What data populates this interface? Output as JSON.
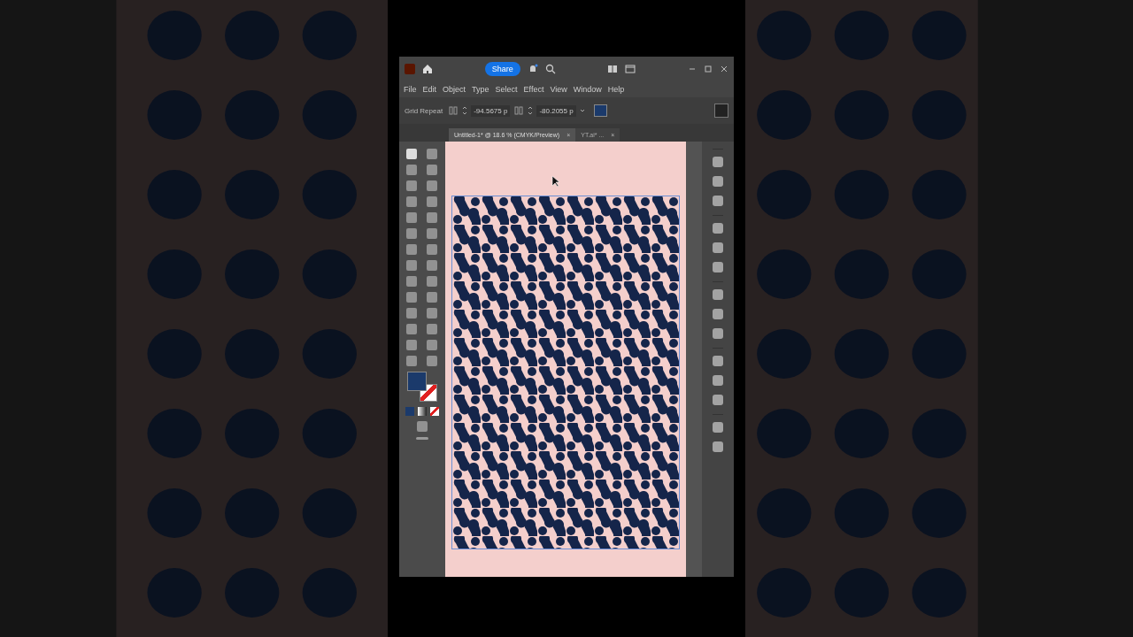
{
  "title_bar": {
    "share_label": "Share"
  },
  "menu": [
    "File",
    "Edit",
    "Object",
    "Type",
    "Select",
    "Effect",
    "View",
    "Window",
    "Help"
  ],
  "control_bar": {
    "label": "Grid Repeat",
    "fields": [
      {
        "value": "-94.5675 p"
      },
      {
        "value": "-80.2055 p"
      }
    ]
  },
  "tabs": [
    {
      "label": "Untitled-1* @ 18.6 % (CMYK/Preview)",
      "close": "×",
      "selected": true
    },
    {
      "label": "YT.ai* ...",
      "close": "×",
      "selected": false
    }
  ]
}
